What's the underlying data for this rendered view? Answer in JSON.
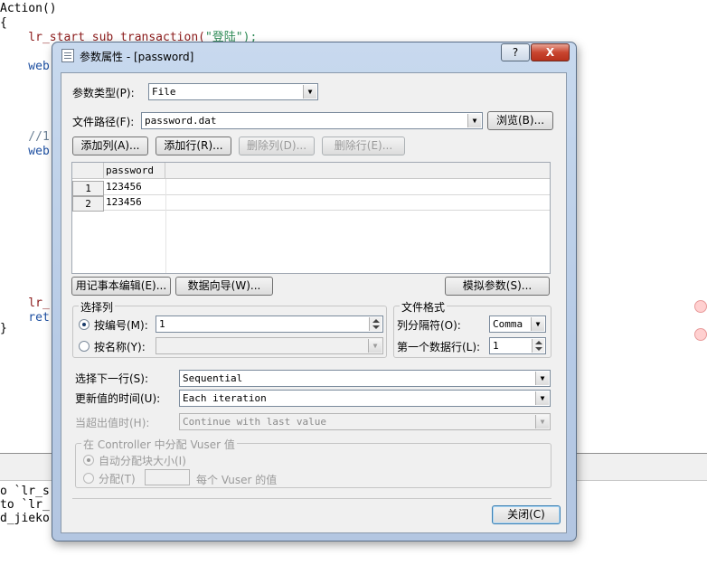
{
  "editor": {
    "lines": [
      {
        "text": "Action()",
        "cls": ""
      },
      {
        "text": "{",
        "cls": ""
      },
      {
        "text": "    lr_start_sub_transaction(",
        "cls": "c-red",
        "tail": "\"登陆\");"
      },
      {
        "text": "    web",
        "cls": "c-blue"
      },
      {
        "text": "    //1",
        "cls": "c-grey"
      },
      {
        "text": "    web",
        "cls": "c-blue"
      },
      {
        "text": "    lr_",
        "cls": "c-red"
      },
      {
        "text": "    ret",
        "cls": "c-blue"
      },
      {
        "text": "}",
        "cls": ""
      }
    ],
    "output_lines": [
      "o `lr_s",
      "to `lr_",
      "d_jieko"
    ]
  },
  "dialog": {
    "title": "参数属性 - [password]",
    "help_label": "?",
    "close_x_label": "X",
    "param_type": {
      "label": "参数类型(P):",
      "value": "File"
    },
    "file_path": {
      "label": "文件路径(F):",
      "value": "password.dat",
      "browse_label": "浏览(B)..."
    },
    "buttons": {
      "add_column": "添加列(A)...",
      "add_row": "添加行(R)...",
      "delete_column": "删除列(D)...",
      "delete_row": "删除行(E)...",
      "notepad_edit": "用记事本编辑(E)...",
      "data_wizard": "数据向导(W)...",
      "simulate": "模拟参数(S)...",
      "close": "关闭(C)"
    },
    "table": {
      "columns": [
        "password"
      ],
      "rows": [
        {
          "num": "1",
          "password": "123456"
        },
        {
          "num": "2",
          "password": "123456"
        }
      ]
    },
    "select_column": {
      "title": "选择列",
      "by_number": {
        "label": "按编号(M):",
        "value": "1",
        "selected": true
      },
      "by_name": {
        "label": "按名称(Y):",
        "value": "",
        "selected": false
      }
    },
    "file_format": {
      "title": "文件格式",
      "delimiter": {
        "label": "列分隔符(O):",
        "value": "Comma"
      },
      "first_data_line": {
        "label": "第一个数据行(L):",
        "value": "1"
      }
    },
    "select_next_row": {
      "label": "选择下一行(S):",
      "value": "Sequential"
    },
    "update_value_on": {
      "label": "更新值的时间(U):",
      "value": "Each iteration"
    },
    "when_out_of_values": {
      "label": "当超出值时(H):",
      "value": "Continue with last value"
    },
    "vuser_alloc": {
      "title": "在 Controller 中分配 Vuser 值",
      "auto": {
        "label": "自动分配块大小(I)",
        "selected": true
      },
      "allocate": {
        "label": "分配(T)",
        "value": "",
        "suffix": "每个 Vuser 的值",
        "selected": false
      }
    }
  }
}
